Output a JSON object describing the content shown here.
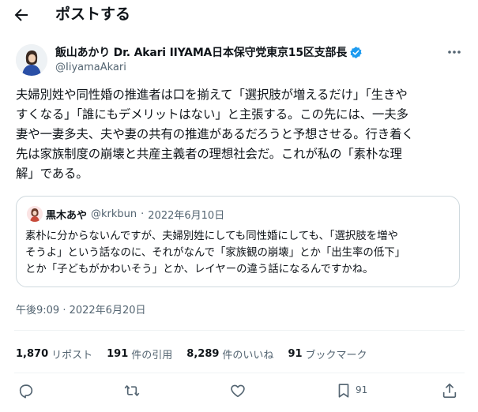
{
  "header": {
    "title": "ポストする",
    "back_icon": "arrow-left-icon"
  },
  "author": {
    "name": "飯山あかり Dr. Akari IIYAMA日本保守党東京15区支部長",
    "handle": "@IiyamaAkari",
    "verified_icon": "verified-badge-icon",
    "verified_color": "#1d9bf0"
  },
  "tweet": {
    "lines": [
      "夫婦別姓や同性婚の推進者は口を揃えて「選択肢が増えるだけ」「生きや",
      "すくなる」「誰にもデメリットはない」と主張する。この先には、一夫多",
      "妻や一妻多夫、夫や妻の共有の推進があるだろうと予想させる。行き着く",
      "先は家族制度の崩壊と共産主義者の理想社会だ。これが私の「素朴な理",
      "解」である。"
    ]
  },
  "quote": {
    "name": "黒木あや",
    "handle": "@krkbun",
    "separator": "·",
    "date": "2022年6月10日",
    "lines": [
      "素朴に分からないんですが、夫婦別姓にしても同性婚にしても、「選択肢を増や",
      "そうよ」という話なのに、それがなんで「家族観の崩壊」とか「出生率の低下」",
      "とか「子どもがかわいそう」とか、レイヤーの違う話になるんですかね。"
    ]
  },
  "timestamp": "午後9:09 · 2022年6月20日",
  "stats": [
    {
      "value": "1,870",
      "label": "リポスト"
    },
    {
      "value": "191",
      "label": "件の引用"
    },
    {
      "value": "8,289",
      "label": "件のいいね"
    },
    {
      "value": "91",
      "label": "ブックマーク"
    }
  ],
  "actions": {
    "reply_icon": "reply-icon",
    "retweet_icon": "retweet-icon",
    "like_icon": "heart-icon",
    "bookmark_icon": "bookmark-icon",
    "bookmark_count": "91",
    "share_icon": "share-icon"
  }
}
